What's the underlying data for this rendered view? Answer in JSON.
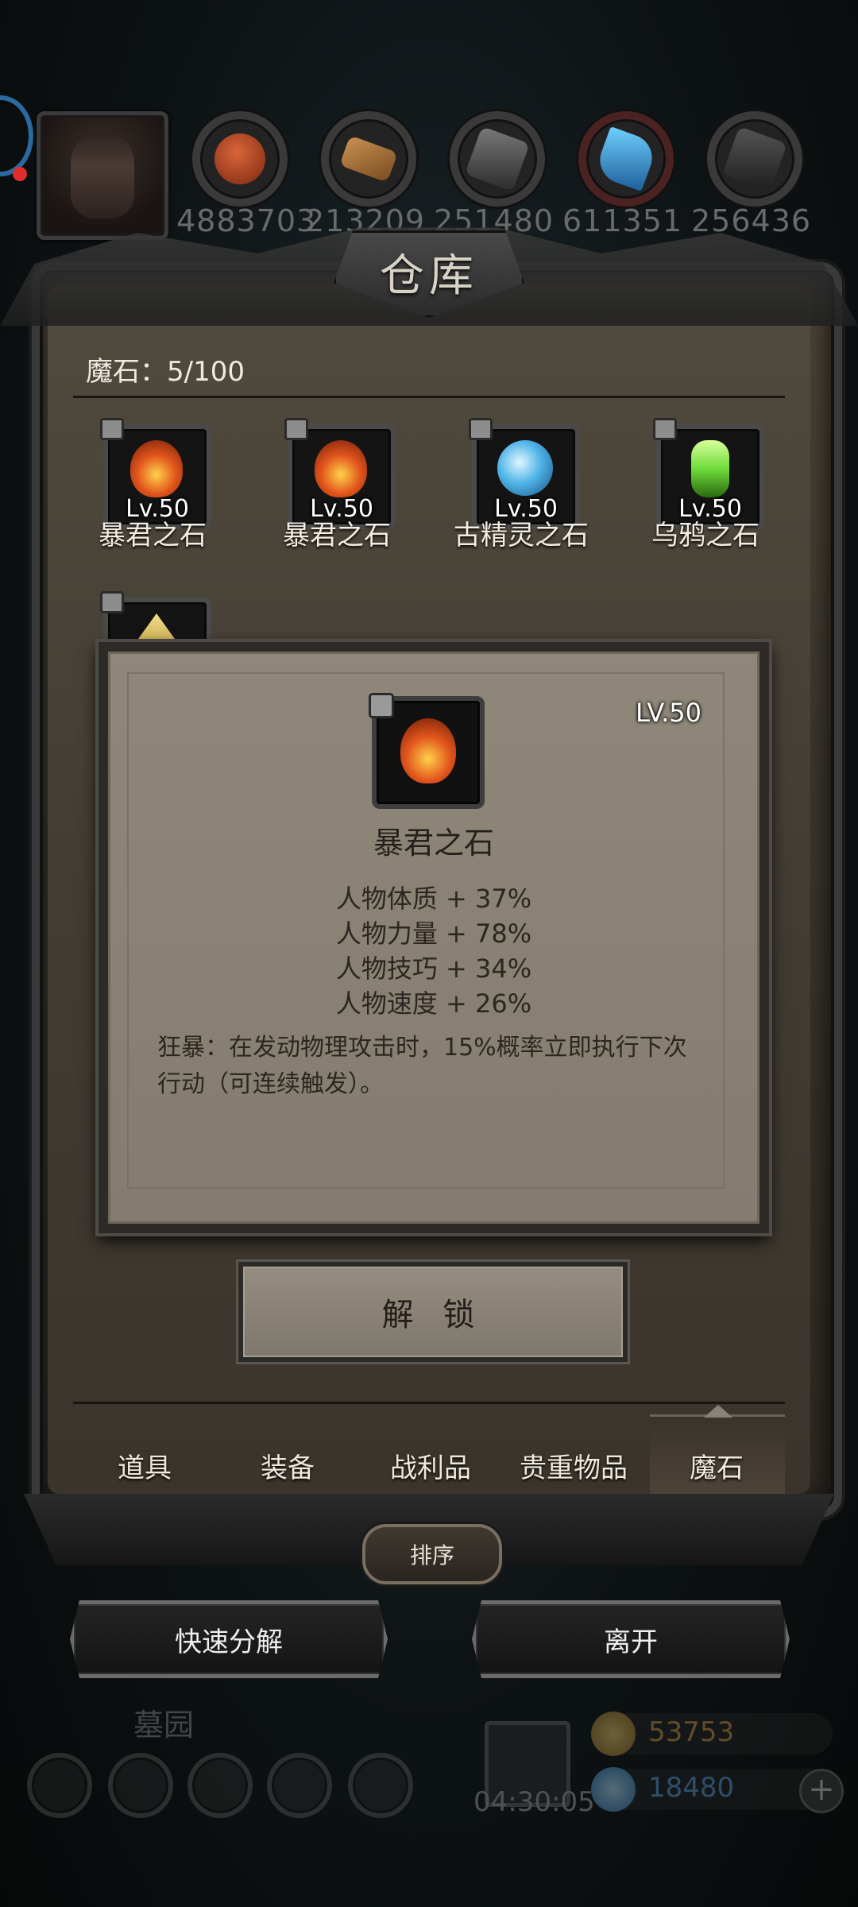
{
  "resources": [
    {
      "icon": "meat-icon",
      "count": "4883703",
      "color": "#b0462a"
    },
    {
      "icon": "wood-icon",
      "count": "213209",
      "color": "#b07a3a"
    },
    {
      "icon": "iron-icon",
      "count": "251480",
      "color": "#5a5a5a"
    },
    {
      "icon": "crystal-icon",
      "count": "611351",
      "color": "#2e8fd4"
    },
    {
      "icon": "steel-icon",
      "count": "256436",
      "color": "#444444"
    }
  ],
  "panel": {
    "title": "仓库",
    "stone_count": "魔石：5/100"
  },
  "items": [
    {
      "name": "暴君之石",
      "level": "Lv.50",
      "gem": "fire"
    },
    {
      "name": "暴君之石",
      "level": "Lv.50",
      "gem": "fire"
    },
    {
      "name": "古精灵之石",
      "level": "Lv.50",
      "gem": "ice"
    },
    {
      "name": "乌鸦之石",
      "level": "Lv.50",
      "gem": "poison"
    },
    {
      "name": "",
      "level": "",
      "gem": "gold"
    }
  ],
  "detail": {
    "level": "LV.50",
    "name": "暴君之石",
    "stats": [
      "人物体质 + 37%",
      "人物力量 + 78%",
      "人物技巧 + 34%",
      "人物速度 + 26%"
    ],
    "description": "狂暴：在发动物理攻击时，15%概率立即执行下次行动（可连续触发）。",
    "unlock_label": "解 锁"
  },
  "tabs": [
    "道具",
    "装备",
    "战利品",
    "贵重物品",
    "魔石"
  ],
  "active_tab": "魔石",
  "sort_label": "排序",
  "actions": {
    "disassemble": "快速分解",
    "leave": "离开"
  },
  "hud": {
    "area_name": "墓园",
    "timer": "04:30:05",
    "gold": "53753",
    "gems": "18480",
    "plus": "+"
  },
  "colors": {
    "fire": "#e2551c",
    "ice": "#4fb4e8",
    "poison": "#6fdc3a",
    "gold": "#c8a84a"
  }
}
